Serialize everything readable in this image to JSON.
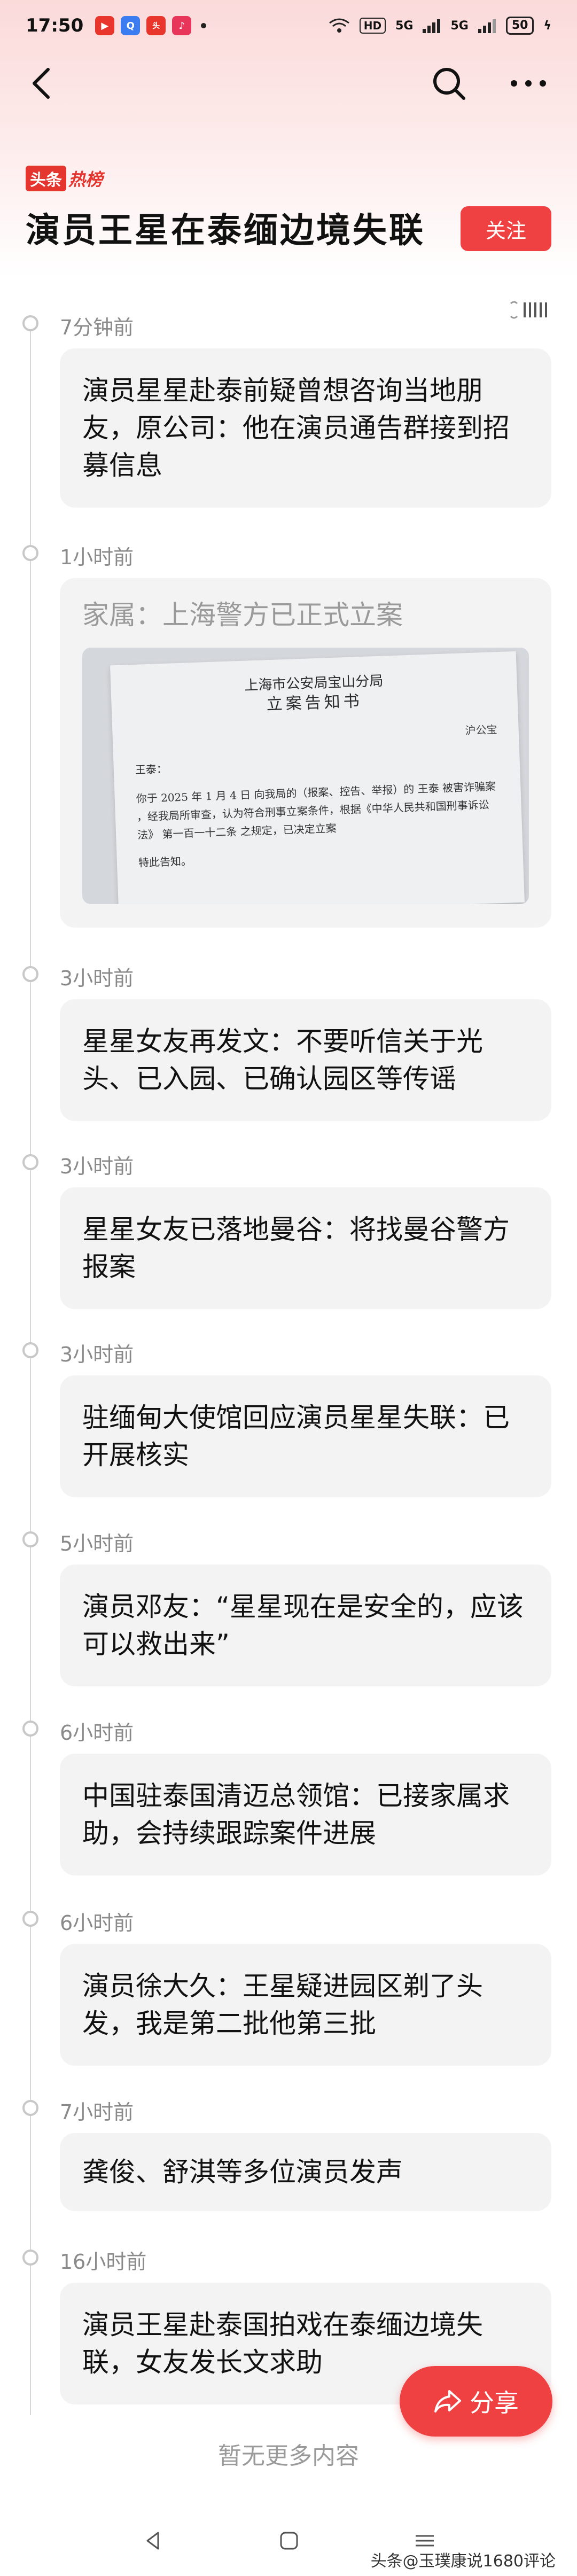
{
  "status_bar": {
    "time": "17:50",
    "network_speed": "HD",
    "signal_1": "5G",
    "signal_2": "5G",
    "battery": "50"
  },
  "topic": {
    "badge_box": "头条",
    "badge_text": "热榜",
    "title": "演员王星在泰缅边境失联",
    "follow_label": "关注"
  },
  "timeline": [
    {
      "time": "7分钟前",
      "text": "演员星星赴泰前疑曾想咨询当地朋友，原公司：他在演员通告群接到招募信息"
    },
    {
      "time": "1小时前",
      "text": "家属：上海警方已正式立案",
      "document": {
        "org": "上海市公安局宝山分局",
        "heading": "立案告知书",
        "ref": "沪公宝",
        "addressee": "王泰：",
        "body": "你于 2025 年 1 月 4 日 向我局的（报案、控告、举报）的 王泰 被害诈骗案 ，经我局所审查，认为符合刑事立案条件，根据《中华人民共和国刑事诉讼法》 第一百一十二条 之规定，已决定立案",
        "tail": "特此告知。"
      }
    },
    {
      "time": "3小时前",
      "text": "星星女友再发文：不要听信关于光头、已入园、已确认园区等传谣"
    },
    {
      "time": "3小时前",
      "text": "星星女友已落地曼谷：将找曼谷警方报案"
    },
    {
      "time": "3小时前",
      "text": "驻缅甸大使馆回应演员星星失联：已开展核实"
    },
    {
      "time": "5小时前",
      "text": "演员邓友：“星星现在是安全的，应该可以救出来”"
    },
    {
      "time": "6小时前",
      "text": "中国驻泰国清迈总领馆：已接家属求助，会持续跟踪案件进展"
    },
    {
      "time": "6小时前",
      "text": "演员徐大久：王星疑进园区剃了头发，我是第二批他第三批"
    },
    {
      "time": "7小时前",
      "text": "龚俊、舒淇等多位演员发声"
    },
    {
      "time": "16小时前",
      "text": "演员王星赴泰国拍戏在泰缅边境失联，女友发长文求助"
    }
  ],
  "footer": {
    "no_more": "暂无更多内容",
    "share_label": "分享",
    "watermark": "头条@玉璞康说1680评论"
  },
  "colors": {
    "accent": "#f04142",
    "card_bg": "#f3f3f4",
    "time_text": "#8a8a8a"
  }
}
